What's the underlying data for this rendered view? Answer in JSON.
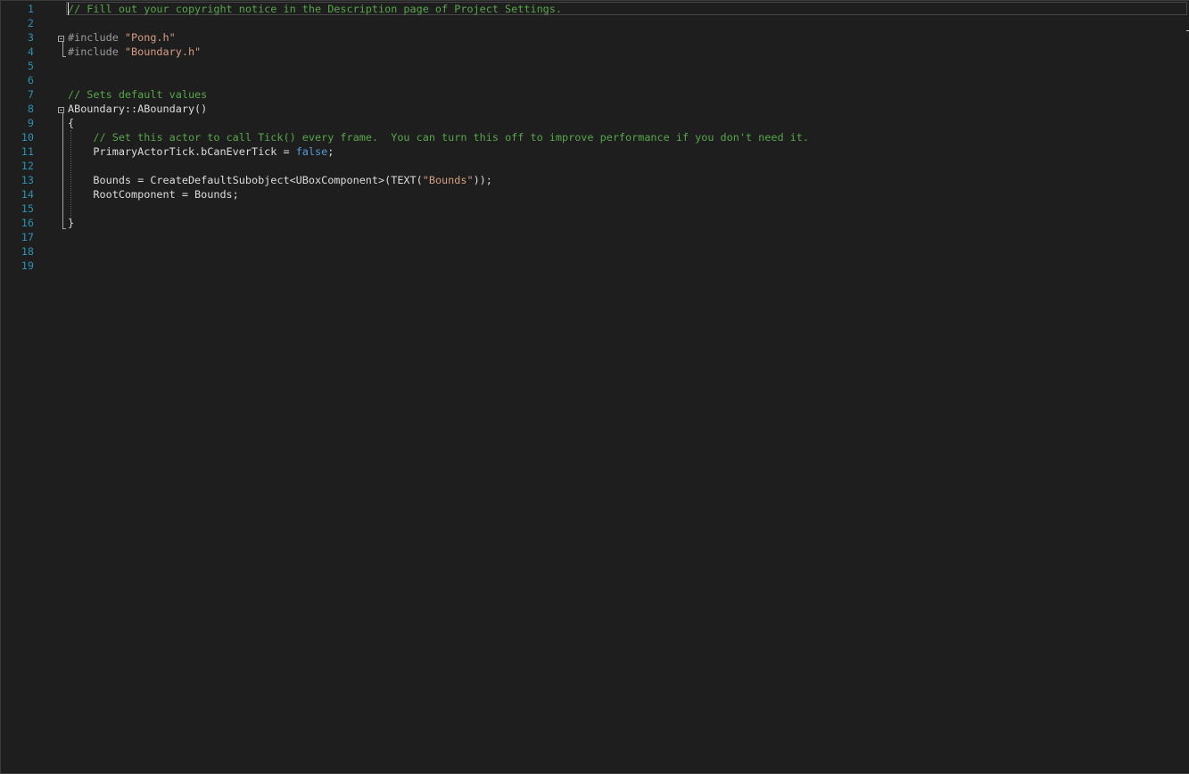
{
  "editor": {
    "line_numbers": [
      "1",
      "2",
      "3",
      "4",
      "5",
      "6",
      "7",
      "8",
      "9",
      "10",
      "11",
      "12",
      "13",
      "14",
      "15",
      "16",
      "17",
      "18",
      "19"
    ],
    "lines": [
      {
        "tokens": [
          {
            "cls": "tok-comment",
            "text": "// Fill out your copyright notice in the Description page of Project Settings."
          }
        ]
      },
      {
        "tokens": []
      },
      {
        "tokens": [
          {
            "cls": "tok-preproc",
            "text": "#include "
          },
          {
            "cls": "tok-string",
            "text": "\"Pong.h\""
          }
        ]
      },
      {
        "tokens": [
          {
            "cls": "tok-preproc",
            "text": "#include "
          },
          {
            "cls": "tok-string",
            "text": "\"Boundary.h\""
          }
        ]
      },
      {
        "tokens": []
      },
      {
        "tokens": []
      },
      {
        "tokens": [
          {
            "cls": "tok-comment",
            "text": "// Sets default values"
          }
        ]
      },
      {
        "tokens": [
          {
            "cls": "tok-plain",
            "text": "ABoundary::ABoundary()"
          }
        ]
      },
      {
        "tokens": [
          {
            "cls": "tok-plain",
            "text": "{"
          }
        ]
      },
      {
        "tokens": [
          {
            "cls": "tok-plain",
            "text": "    "
          },
          {
            "cls": "tok-comment",
            "text": "// Set this actor to call Tick() every frame.  You can turn this off to improve performance if you don't need it."
          }
        ]
      },
      {
        "tokens": [
          {
            "cls": "tok-plain",
            "text": "    PrimaryActorTick.bCanEverTick = "
          },
          {
            "cls": "tok-keyword",
            "text": "false"
          },
          {
            "cls": "tok-plain",
            "text": ";"
          }
        ]
      },
      {
        "tokens": []
      },
      {
        "tokens": [
          {
            "cls": "tok-plain",
            "text": "    Bounds = CreateDefaultSubobject<UBoxComponent>(TEXT("
          },
          {
            "cls": "tok-string",
            "text": "\"Bounds\""
          },
          {
            "cls": "tok-plain",
            "text": "));"
          }
        ]
      },
      {
        "tokens": [
          {
            "cls": "tok-plain",
            "text": "    RootComponent = Bounds;"
          }
        ]
      },
      {
        "tokens": []
      },
      {
        "tokens": [
          {
            "cls": "tok-plain",
            "text": "}"
          }
        ]
      },
      {
        "tokens": []
      },
      {
        "tokens": []
      },
      {
        "tokens": []
      }
    ]
  },
  "colors": {
    "background": "#1e1e1e",
    "line_number": "#2b91af",
    "comment": "#57a64a",
    "string": "#d69d85",
    "keyword": "#569cd6",
    "preprocessor": "#9b9b9b",
    "text": "#dcdcdc"
  },
  "icons": {
    "fold": "collapse-box-icon"
  }
}
